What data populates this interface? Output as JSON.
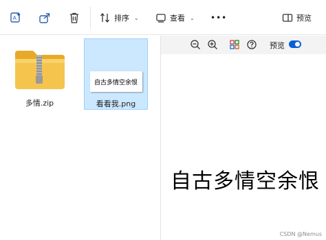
{
  "toolbar": {
    "sort_label": "排序",
    "view_label": "查看",
    "more_label": "•••",
    "preview_label": "预览"
  },
  "files": [
    {
      "name": "多情.zip",
      "type": "zip"
    },
    {
      "name": "看看我.png",
      "type": "png",
      "thumb_text": "自古多情空余恨",
      "selected": true
    }
  ],
  "preview_pane": {
    "toggle_label": "预览",
    "toggle_on": true,
    "content_text": "自古多情空余恨"
  },
  "watermark": "CSDN @Nemus",
  "colors": {
    "accent": "#0a5fd6",
    "selection": "#cce8ff",
    "folder": "#f3c24b"
  }
}
